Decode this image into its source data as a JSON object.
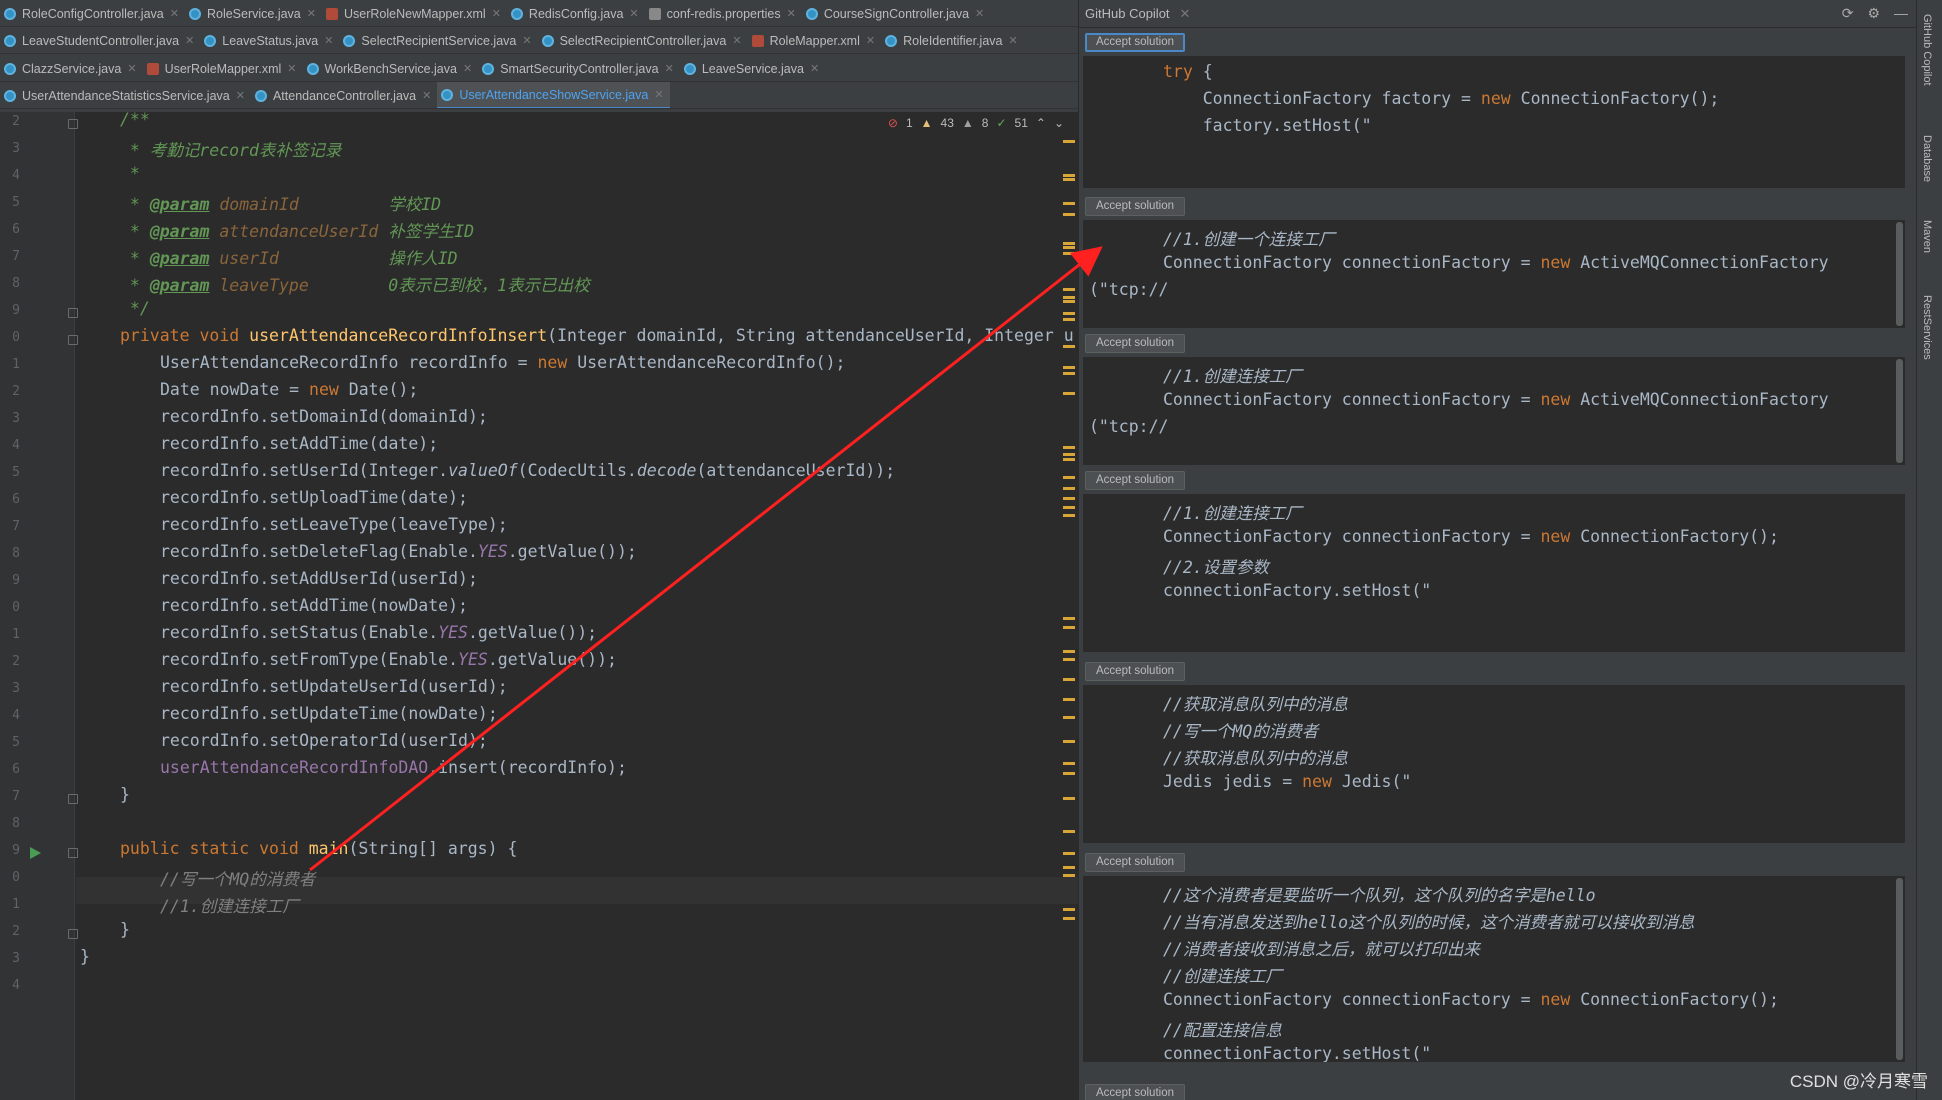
{
  "tabs": {
    "row1": [
      {
        "label": "RoleConfigController.java",
        "icon": "java"
      },
      {
        "label": "RoleService.java",
        "icon": "java"
      },
      {
        "label": "UserRoleNewMapper.xml",
        "icon": "xml"
      },
      {
        "label": "RedisConfig.java",
        "icon": "java"
      },
      {
        "label": "conf-redis.properties",
        "icon": "prop"
      },
      {
        "label": "CourseSignController.java",
        "icon": "java"
      }
    ],
    "row2": [
      {
        "label": "LeaveStudentController.java",
        "icon": "java"
      },
      {
        "label": "LeaveStatus.java",
        "icon": "java"
      },
      {
        "label": "SelectRecipientService.java",
        "icon": "java"
      },
      {
        "label": "SelectRecipientController.java",
        "icon": "java"
      },
      {
        "label": "RoleMapper.xml",
        "icon": "xml"
      },
      {
        "label": "RoleIdentifier.java",
        "icon": "java"
      }
    ],
    "row3": [
      {
        "label": "ClazzService.java",
        "icon": "java"
      },
      {
        "label": "UserRoleMapper.xml",
        "icon": "xml"
      },
      {
        "label": "WorkBenchService.java",
        "icon": "java"
      },
      {
        "label": "SmartSecurityController.java",
        "icon": "java"
      },
      {
        "label": "LeaveService.java",
        "icon": "java"
      }
    ],
    "row4": [
      {
        "label": "UserAttendanceStatisticsService.java",
        "icon": "java"
      },
      {
        "label": "AttendanceController.java",
        "icon": "java"
      },
      {
        "label": "UserAttendanceShowService.java",
        "icon": "java",
        "active": true
      }
    ]
  },
  "inspection": {
    "errors": "1",
    "warnings": "43",
    "weak_warnings": "8",
    "typos": "51"
  },
  "editor": {
    "line_numbers": [
      "2",
      "3",
      "4",
      "5",
      "6",
      "7",
      "8",
      "9",
      "0",
      "1",
      "2",
      "3",
      "4",
      "5",
      "6",
      "7",
      "8",
      "9",
      "0",
      "1",
      "2",
      "3",
      "4",
      "5",
      "6",
      "7",
      "8",
      "9",
      "0",
      "1",
      "2",
      "3",
      "4"
    ],
    "doc_open": "/**",
    "doc_title": " * 考勤记record表补签记录",
    "doc_star": " *",
    "params": [
      {
        "name": "domainId",
        "pad": "         ",
        "desc": "学校ID"
      },
      {
        "name": "attendanceUserId",
        "pad": " ",
        "desc": "补签学生ID"
      },
      {
        "name": "userId",
        "pad": "           ",
        "desc": "操作人ID"
      },
      {
        "name": "leaveType",
        "pad": "        ",
        "desc": "0表示已到校，1表示已出校"
      }
    ],
    "doc_close": " */",
    "param_tag": "@param",
    "method_sig_kw": "private void ",
    "method_sig_name": "userAttendanceRecordInfoInsert",
    "method_sig_rest": "(Integer domainId, String attendanceUserId, Integer u",
    "body": [
      "UserAttendanceRecordInfo recordInfo = ",
      "Date nowDate = "
    ],
    "new_kw": "new ",
    "body_new_rest": [
      "UserAttendanceRecordInfo();",
      "Date();"
    ],
    "setters": [
      "recordInfo.setDomainId(domainId);",
      "recordInfo.setAddTime(date);",
      "recordInfo.setUserId(Integer.",
      "recordInfo.setUploadTime(date);",
      "recordInfo.setLeaveType(leaveType);",
      "recordInfo.setDeleteFlag(Enable.",
      "recordInfo.setAddUserId(userId);",
      "recordInfo.setAddTime(nowDate);",
      "recordInfo.setStatus(Enable.",
      "recordInfo.setFromType(Enable.",
      "recordInfo.setUpdateUserId(userId);",
      "recordInfo.setUpdateTime(nowDate);",
      "recordInfo.setOperatorId(userId);"
    ],
    "valueof": "valueOf",
    "codec_pre": "(CodecUtils.",
    "decode": "decode",
    "codec_post": "(attendanceUserId));",
    "yes": "YES",
    "getvalue": ".getValue());",
    "dao_field": "userAttendanceRecordInfoDAO",
    "dao_call": ".insert(recordInfo);",
    "close_brace": "}",
    "main_kw": "public static void ",
    "main_name": "main",
    "main_rest": "(String[] args) {",
    "main_c1": "//写一个MQ的消费者",
    "main_c2": "//1.创建连接工厂"
  },
  "copilot": {
    "title": "GitHub Copilot",
    "accept_label": "Accept solution",
    "solutions": [
      [
        "try {",
        "    ConnectionFactory factory = new ConnectionFactory();",
        "    factory.setHost(\""
      ],
      [
        "//1.创建一个连接工厂",
        "ConnectionFactory connectionFactory = new ActiveMQConnectionFactory",
        "(\"tcp://"
      ],
      [
        "//1.创建连接工厂",
        "ConnectionFactory connectionFactory = new ActiveMQConnectionFactory",
        "(\"tcp://"
      ],
      [
        "//1.创建连接工厂",
        "ConnectionFactory connectionFactory = new ConnectionFactory();",
        "//2.设置参数",
        "connectionFactory.setHost(\""
      ],
      [
        "//获取消息队列中的消息",
        "//写一个MQ的消费者",
        "//获取消息队列中的消息",
        "Jedis jedis = new Jedis(\""
      ],
      [
        "//这个消费者是要监听一个队列，这个队列的名字是hello",
        "//当有消息发送到hello这个队列的时候，这个消费者就可以接收到消息",
        "//消费者接收到消息之后，就可以打印出来",
        "//创建连接工厂",
        "ConnectionFactory connectionFactory = new ConnectionFactory();",
        "//配置连接信息",
        "connectionFactory.setHost(\""
      ]
    ]
  },
  "right_strip": [
    "GitHub Copilot",
    "Database",
    "Maven",
    "RestServices"
  ],
  "watermark": "CSDN @冷月寒雪",
  "colors": {
    "arrow": "#ff2020",
    "accent": "#4a88c7"
  }
}
